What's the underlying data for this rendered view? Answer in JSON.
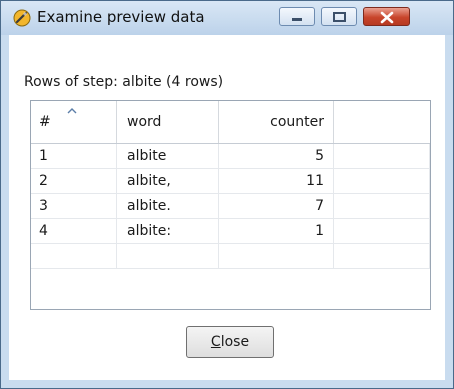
{
  "window": {
    "title": "Examine preview data",
    "icon": "spoon-icon",
    "controls": [
      "minimize",
      "maximize",
      "close"
    ]
  },
  "rows_label": "Rows of step: albite (4 rows)",
  "table": {
    "columns": [
      "#",
      "word",
      "counter",
      ""
    ],
    "sort_column": "#",
    "rows": [
      {
        "num": "1",
        "word": "albite",
        "counter": "5"
      },
      {
        "num": "2",
        "word": "albite,",
        "counter": "11"
      },
      {
        "num": "3",
        "word": "albite.",
        "counter": "7"
      },
      {
        "num": "4",
        "word": "albite:",
        "counter": "1"
      }
    ]
  },
  "close_button": {
    "mnemonic": "C",
    "rest": "lose"
  },
  "colors": {
    "title_bar": "#bcd2ea",
    "close_control": "#c8452c",
    "grid_border": "#9aa6b4"
  }
}
